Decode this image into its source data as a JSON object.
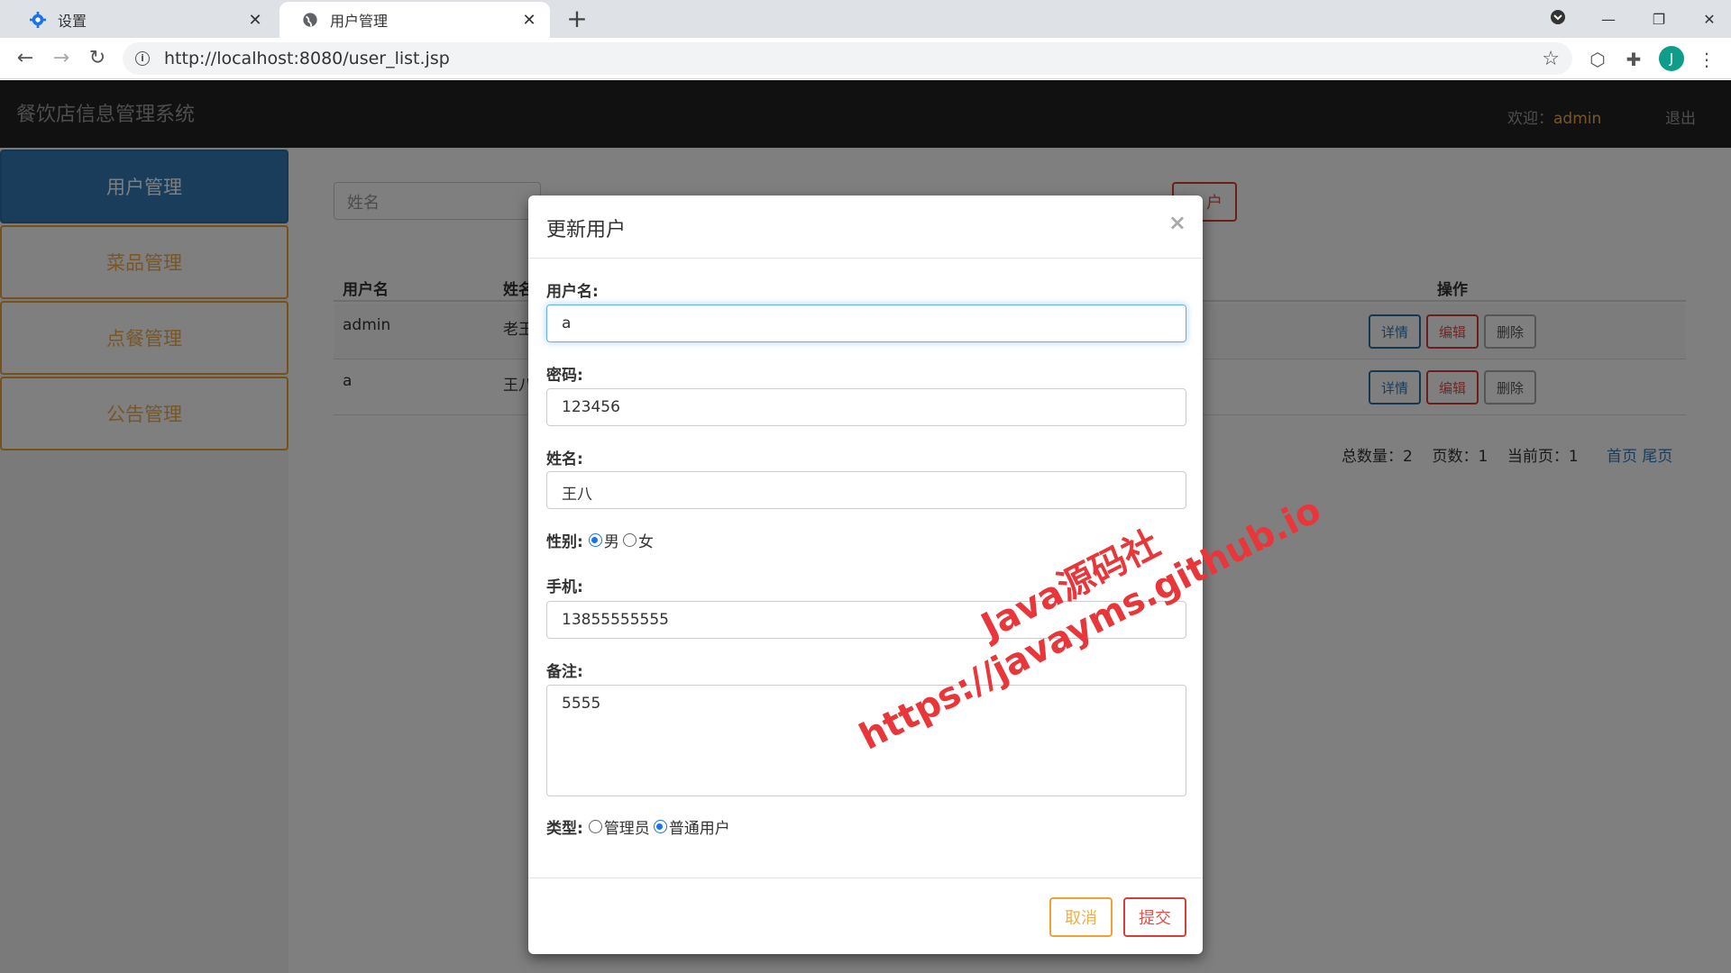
{
  "browser": {
    "tabs": [
      {
        "title": "设置",
        "icon": "gear-icon"
      },
      {
        "title": "用户管理",
        "icon": "globe-icon"
      }
    ],
    "url_host": "http://localhost:8080/user_list.jsp",
    "profile_initial": "J"
  },
  "app": {
    "brand": "餐饮店信息管理系统",
    "welcome_label": "欢迎：",
    "welcome_user": "admin",
    "logout": "退出"
  },
  "sidebar": {
    "items": [
      {
        "label": "用户管理",
        "active": true
      },
      {
        "label": "菜品管理"
      },
      {
        "label": "点餐管理"
      },
      {
        "label": "公告管理"
      }
    ]
  },
  "search": {
    "placeholder": "姓名",
    "add_button": "户"
  },
  "table": {
    "headers": [
      "用户名",
      "姓名",
      "操作"
    ],
    "rows": [
      {
        "username": "admin",
        "name": "老王"
      },
      {
        "username": "a",
        "name": "王八"
      }
    ],
    "actions": [
      "详情",
      "编辑",
      "删除"
    ]
  },
  "pager": {
    "total_label": "总数量：",
    "total": "2",
    "pages_label": "页数：",
    "pages": "1",
    "current_label": "当前页：",
    "current": "1",
    "first": "首页",
    "last": "尾页"
  },
  "modal": {
    "title": "更新用户",
    "close": "×",
    "username_label": "用户名:",
    "username_value": "a",
    "password_label": "密码:",
    "password_value": "123456",
    "name_label": "姓名:",
    "name_value": "王八",
    "gender_label": "性别:",
    "gender_options": [
      "男",
      "女"
    ],
    "phone_label": "手机:",
    "phone_value": "13855555555",
    "remark_label": "备注:",
    "remark_value": "5555",
    "type_label": "类型:",
    "type_options": [
      "管理员",
      "普通用户"
    ],
    "cancel": "取消",
    "submit": "提交"
  },
  "watermark": {
    "line1": "Java源码社",
    "line2": "https://javayms.github.io"
  }
}
